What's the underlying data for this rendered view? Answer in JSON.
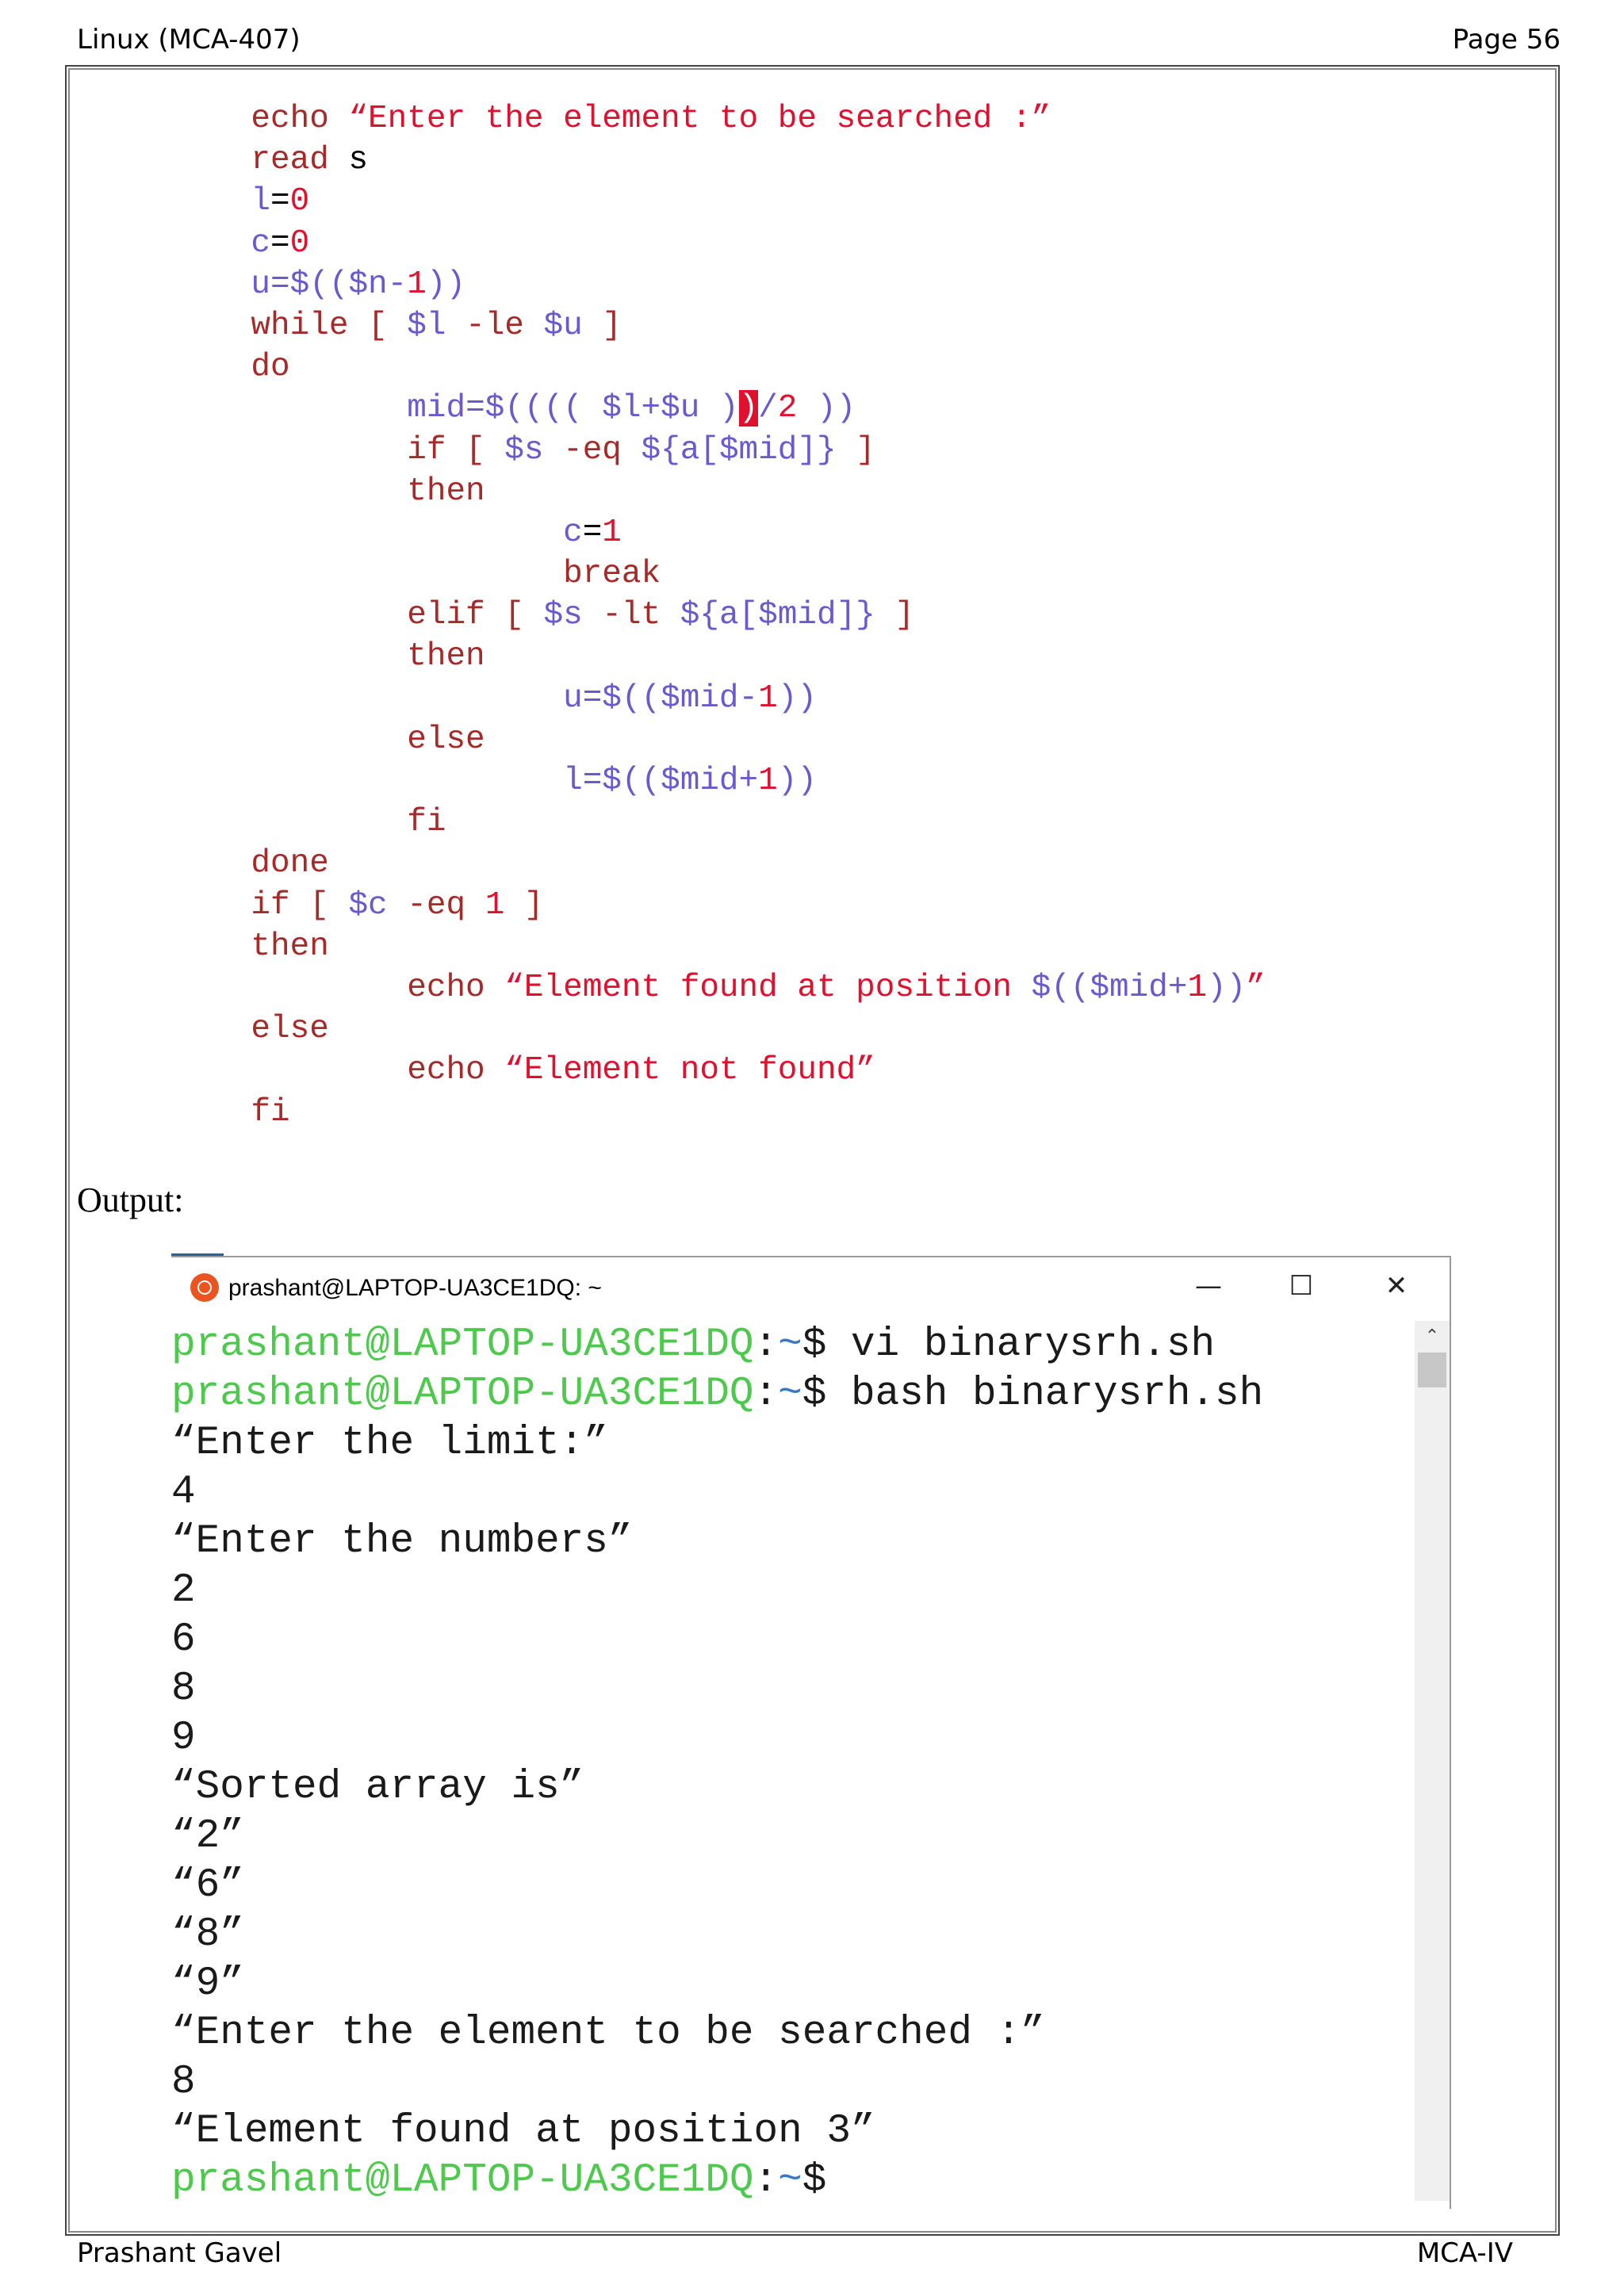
{
  "header": {
    "left": "Linux (MCA-407)",
    "right": "Page 56"
  },
  "footer": {
    "left": "Prashant Gavel",
    "right": "MCA-IV"
  },
  "code_lines": [
    [
      {
        "t": "    echo ",
        "c": "cmd"
      },
      {
        "t": "“Enter the element to be searched :”",
        "c": "str"
      }
    ],
    [
      {
        "t": "    read ",
        "c": "cmd"
      },
      {
        "t": "s",
        "c": ""
      }
    ],
    [
      {
        "t": "    l",
        "c": "var"
      },
      {
        "t": "=",
        "c": ""
      },
      {
        "t": "0",
        "c": "num"
      }
    ],
    [
      {
        "t": "    c",
        "c": "var"
      },
      {
        "t": "=",
        "c": ""
      },
      {
        "t": "0",
        "c": "num"
      }
    ],
    [
      {
        "t": "    u",
        "c": "var"
      },
      {
        "t": "=$((",
        "c": "var"
      },
      {
        "t": "$n",
        "c": "var"
      },
      {
        "t": "-",
        "c": "var"
      },
      {
        "t": "1",
        "c": "num"
      },
      {
        "t": "))",
        "c": "var"
      }
    ],
    [
      {
        "t": "    while ",
        "c": "cmd"
      },
      {
        "t": "[ ",
        "c": "cmd"
      },
      {
        "t": "$l",
        "c": "var"
      },
      {
        "t": " -le ",
        "c": "cmd"
      },
      {
        "t": "$u",
        "c": "var"
      },
      {
        "t": " ]",
        "c": "cmd"
      }
    ],
    [
      {
        "t": "    do",
        "c": "cmd"
      }
    ],
    [
      {
        "t": "            mid",
        "c": "var"
      },
      {
        "t": "=$(((( ",
        "c": "var"
      },
      {
        "t": "$l",
        "c": "var"
      },
      {
        "t": "+",
        "c": "var"
      },
      {
        "t": "$u",
        "c": "var"
      },
      {
        "t": " )",
        "c": "var"
      },
      {
        "t": ")",
        "c": "cursor"
      },
      {
        "t": "/",
        "c": "var"
      },
      {
        "t": "2",
        "c": "num"
      },
      {
        "t": " ))",
        "c": "var"
      }
    ],
    [
      {
        "t": "            if ",
        "c": "cmd"
      },
      {
        "t": "[ ",
        "c": "cmd"
      },
      {
        "t": "$s",
        "c": "var"
      },
      {
        "t": " -eq ",
        "c": "cmd"
      },
      {
        "t": "${a[$mid]}",
        "c": "var"
      },
      {
        "t": " ]",
        "c": "cmd"
      }
    ],
    [
      {
        "t": "            then",
        "c": "cmd"
      }
    ],
    [
      {
        "t": "                    c",
        "c": "var"
      },
      {
        "t": "=",
        "c": ""
      },
      {
        "t": "1",
        "c": "num"
      }
    ],
    [
      {
        "t": "                    break",
        "c": "cmd"
      }
    ],
    [
      {
        "t": "            elif ",
        "c": "cmd"
      },
      {
        "t": "[ ",
        "c": "cmd"
      },
      {
        "t": "$s",
        "c": "var"
      },
      {
        "t": " -lt ",
        "c": "cmd"
      },
      {
        "t": "${a[$mid]}",
        "c": "var"
      },
      {
        "t": " ]",
        "c": "cmd"
      }
    ],
    [
      {
        "t": "            then",
        "c": "cmd"
      }
    ],
    [
      {
        "t": "                    u",
        "c": "var"
      },
      {
        "t": "=$((",
        "c": "var"
      },
      {
        "t": "$mid",
        "c": "var"
      },
      {
        "t": "-",
        "c": "var"
      },
      {
        "t": "1",
        "c": "num"
      },
      {
        "t": "))",
        "c": "var"
      }
    ],
    [
      {
        "t": "            else",
        "c": "cmd"
      }
    ],
    [
      {
        "t": "                    l",
        "c": "var"
      },
      {
        "t": "=$((",
        "c": "var"
      },
      {
        "t": "$mid",
        "c": "var"
      },
      {
        "t": "+",
        "c": "var"
      },
      {
        "t": "1",
        "c": "num"
      },
      {
        "t": "))",
        "c": "var"
      }
    ],
    [
      {
        "t": "            fi",
        "c": "cmd"
      }
    ],
    [
      {
        "t": "    done",
        "c": "cmd"
      }
    ],
    [
      {
        "t": "    if ",
        "c": "cmd"
      },
      {
        "t": "[ ",
        "c": "cmd"
      },
      {
        "t": "$c",
        "c": "var"
      },
      {
        "t": " -eq ",
        "c": "cmd"
      },
      {
        "t": "1",
        "c": "num"
      },
      {
        "t": " ]",
        "c": "cmd"
      }
    ],
    [
      {
        "t": "    then",
        "c": "cmd"
      }
    ],
    [
      {
        "t": "            echo ",
        "c": "cmd"
      },
      {
        "t": "“Element found at position ",
        "c": "str"
      },
      {
        "t": "$((",
        "c": "var"
      },
      {
        "t": "$mid",
        "c": "var"
      },
      {
        "t": "+",
        "c": "var"
      },
      {
        "t": "1",
        "c": "num"
      },
      {
        "t": "))",
        "c": "var"
      },
      {
        "t": "”",
        "c": "str"
      }
    ],
    [
      {
        "t": "    else",
        "c": "cmd"
      }
    ],
    [
      {
        "t": "            echo ",
        "c": "cmd"
      },
      {
        "t": "“Element not found”",
        "c": "str"
      }
    ],
    [
      {
        "t": "    fi",
        "c": "cmd"
      }
    ]
  ],
  "output_label": "Output:",
  "terminal": {
    "title": "prashant@LAPTOP-UA3CE1DQ: ~",
    "buttons": {
      "minimize": "—",
      "maximize": "☐",
      "close": "✕"
    },
    "scroll_up": "⌃",
    "lines": [
      {
        "type": "prompt",
        "user": "prashant@LAPTOP-UA3CE1DQ",
        "sep": ":",
        "path": "~",
        "dollar": "$ ",
        "cmd": "vi binarysrh.sh"
      },
      {
        "type": "prompt",
        "user": "prashant@LAPTOP-UA3CE1DQ",
        "sep": ":",
        "path": "~",
        "dollar": "$ ",
        "cmd": "bash binarysrh.sh"
      },
      {
        "type": "text",
        "text": "“Enter the limit:”"
      },
      {
        "type": "text",
        "text": "4"
      },
      {
        "type": "text",
        "text": "“Enter the numbers”"
      },
      {
        "type": "text",
        "text": "2"
      },
      {
        "type": "text",
        "text": "6"
      },
      {
        "type": "text",
        "text": "8"
      },
      {
        "type": "text",
        "text": "9"
      },
      {
        "type": "text",
        "text": "“Sorted array is”"
      },
      {
        "type": "text",
        "text": "“2”"
      },
      {
        "type": "text",
        "text": "“6”"
      },
      {
        "type": "text",
        "text": "“8”"
      },
      {
        "type": "text",
        "text": "“9”"
      },
      {
        "type": "text",
        "text": "“Enter the element to be searched :”"
      },
      {
        "type": "text",
        "text": "8"
      },
      {
        "type": "text",
        "text": "“Element found at position 3”"
      },
      {
        "type": "prompt",
        "user": "prashant@LAPTOP-UA3CE1DQ",
        "sep": ":",
        "path": "~",
        "dollar": "$",
        "cmd": ""
      }
    ]
  },
  "colors": {
    "prompt_user": "#4ec94e",
    "prompt_path": "#3b78c2",
    "string": "#e0102f",
    "keyword": "#a52a2a",
    "variable": "#6a5acd"
  }
}
